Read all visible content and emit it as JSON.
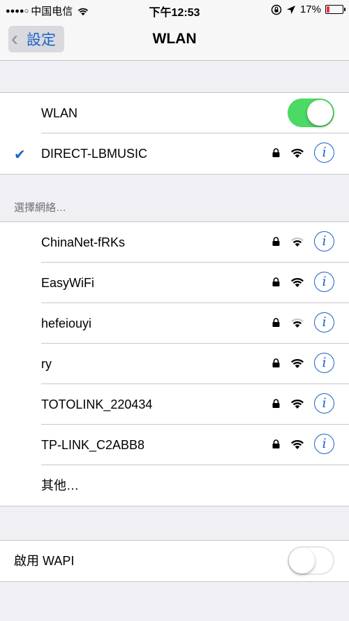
{
  "status_bar": {
    "signal": "●●●●○",
    "carrier": "中国电信",
    "time": "下午12:53",
    "battery_text": "17%",
    "battery_level": 0.17,
    "colors": {
      "battery_low": "#e8323b"
    }
  },
  "nav": {
    "back_label": "設定",
    "title": "WLAN"
  },
  "wlan_toggle": {
    "label": "WLAN",
    "on": true
  },
  "connected": {
    "name": "DIRECT-LBMUSIC",
    "secured": true,
    "info": "i"
  },
  "section_header": "選擇網絡…",
  "networks": [
    {
      "name": "ChinaNet-fRKs",
      "secured": true,
      "signal": "medium",
      "info": "i"
    },
    {
      "name": "EasyWiFi",
      "secured": true,
      "signal": "strong",
      "info": "i"
    },
    {
      "name": "hefeiouyi",
      "secured": true,
      "signal": "medium",
      "info": "i"
    },
    {
      "name": "ry",
      "secured": true,
      "signal": "strong",
      "info": "i"
    },
    {
      "name": "TOTOLINK_220434",
      "secured": true,
      "signal": "strong",
      "info": "i"
    },
    {
      "name": "TP-LINK_C2ABB8",
      "secured": true,
      "signal": "strong",
      "info": "i"
    }
  ],
  "other_label": "其他…",
  "wapi_toggle": {
    "label": "啟用 WAPI",
    "on": false
  },
  "colors": {
    "accent": "#1a64c8",
    "toggle_on": "#4cd964",
    "background": "#efeff4"
  }
}
